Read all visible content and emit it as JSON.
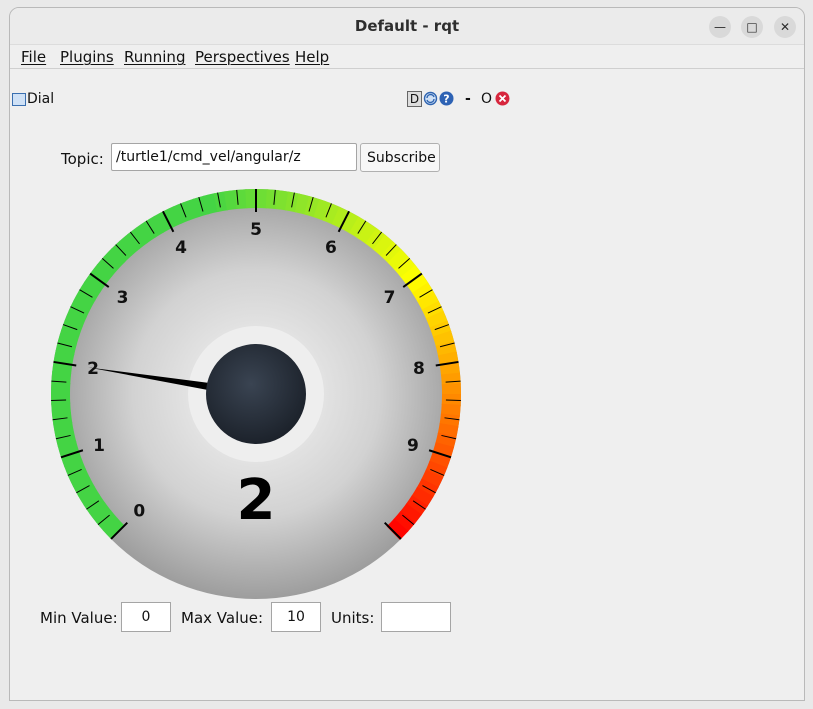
{
  "window": {
    "title": "Default - rqt"
  },
  "menu": [
    "File",
    "Plugins",
    "Running",
    "Perspectives",
    "Help"
  ],
  "dock": {
    "title": "Dial",
    "buttons": [
      "D",
      "-",
      "O"
    ]
  },
  "topic": {
    "label": "Topic:",
    "value": "/turtle1/cmd_vel/angular/z",
    "subscribe_label": "Subscribe"
  },
  "dial": {
    "min": 0,
    "max": 10,
    "value": 2,
    "value_display": "2",
    "tick_labels": [
      "0",
      "1",
      "2",
      "3",
      "4",
      "5",
      "6",
      "7",
      "8",
      "9"
    ],
    "colors": {
      "low": "#44d444",
      "mid": "#ffff00",
      "high": "#ff0000"
    }
  },
  "bottom": {
    "min_label": "Min Value:",
    "min_value": "0",
    "max_label": "Max Value:",
    "max_value": "10",
    "units_label": "Units:",
    "units_value": ""
  }
}
